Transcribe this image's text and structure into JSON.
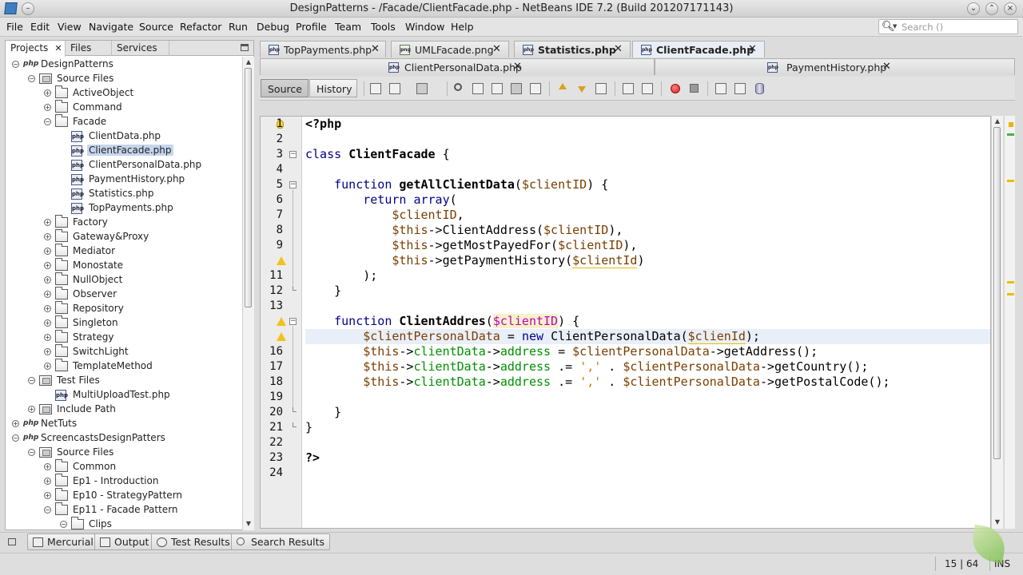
{
  "window": {
    "title": "DesignPatterns - /Facade/ClientFacade.php - NetBeans IDE 7.2 (Build 201207171143)"
  },
  "menu": {
    "items": [
      "File",
      "Edit",
      "View",
      "Navigate",
      "Source",
      "Refactor",
      "Run",
      "Debug",
      "Profile",
      "Team",
      "Tools",
      "Window",
      "Help"
    ]
  },
  "search": {
    "placeholder": "Search ()"
  },
  "left_panel": {
    "tabs": [
      "Projects",
      "Files",
      "Services"
    ],
    "tree": [
      {
        "label": "DesignPatterns",
        "type": "project"
      },
      {
        "label": "Source Files",
        "type": "srcfolder"
      },
      {
        "label": "ActiveObject",
        "type": "folder"
      },
      {
        "label": "Command",
        "type": "folder"
      },
      {
        "label": "Facade",
        "type": "folder"
      },
      {
        "label": "ClientData.php",
        "type": "php"
      },
      {
        "label": "ClientFacade.php",
        "type": "php",
        "selected": true
      },
      {
        "label": "ClientPersonalData.php",
        "type": "php"
      },
      {
        "label": "PaymentHistory.php",
        "type": "php"
      },
      {
        "label": "Statistics.php",
        "type": "php"
      },
      {
        "label": "TopPayments.php",
        "type": "php"
      },
      {
        "label": "Factory",
        "type": "folder"
      },
      {
        "label": "Gateway&Proxy",
        "type": "folder"
      },
      {
        "label": "Mediator",
        "type": "folder"
      },
      {
        "label": "Monostate",
        "type": "folder"
      },
      {
        "label": "NullObject",
        "type": "folder"
      },
      {
        "label": "Observer",
        "type": "folder"
      },
      {
        "label": "Repository",
        "type": "folder"
      },
      {
        "label": "Singleton",
        "type": "folder"
      },
      {
        "label": "Strategy",
        "type": "folder"
      },
      {
        "label": "SwitchLight",
        "type": "folder"
      },
      {
        "label": "TemplateMethod",
        "type": "folder"
      },
      {
        "label": "Test Files",
        "type": "srcfolder"
      },
      {
        "label": "MultiUploadTest.php",
        "type": "php"
      },
      {
        "label": "Include Path",
        "type": "srcfolder"
      },
      {
        "label": "NetTuts",
        "type": "project"
      },
      {
        "label": "ScreencastsDesignPatters",
        "type": "project"
      },
      {
        "label": "Source Files",
        "type": "srcfolder"
      },
      {
        "label": "Common",
        "type": "folder"
      },
      {
        "label": "Ep1 - Introduction",
        "type": "folder"
      },
      {
        "label": "Ep10 - StrategyPattern",
        "type": "folder"
      },
      {
        "label": "Ep11 - Facade Pattern",
        "type": "folder"
      },
      {
        "label": "Clips",
        "type": "folder"
      }
    ]
  },
  "editor_tabs": {
    "row1": [
      "TopPayments.php",
      "UMLFacade.png",
      "Statistics.php",
      "ClientFacade.php"
    ],
    "row2": [
      "ClientPersonalData.php",
      "PaymentHistory.php"
    ]
  },
  "editor_toolbar": {
    "source_label": "Source",
    "history_label": "History"
  },
  "code": {
    "line_numbers": [
      "1",
      "2",
      "3",
      "4",
      "5",
      "6",
      "7",
      "8",
      "9",
      "",
      "11",
      "12",
      "13",
      "",
      "",
      "16",
      "17",
      "18",
      "19",
      "20",
      "21",
      "22",
      "23",
      "24"
    ],
    "lines": [
      [
        [
          "kwb",
          "<?php"
        ]
      ],
      [],
      [
        [
          "kw",
          "class "
        ],
        [
          "fn",
          "ClientFacade"
        ],
        [
          "",
          " {"
        ]
      ],
      [],
      [
        [
          "",
          "    "
        ],
        [
          "kw",
          "function "
        ],
        [
          "fn",
          "getAllClientData"
        ],
        [
          "",
          "("
        ],
        [
          "var",
          "$clientID"
        ],
        [
          "",
          ") {"
        ]
      ],
      [
        [
          "",
          "        "
        ],
        [
          "kw",
          "return "
        ],
        [
          "kw",
          "array"
        ],
        [
          "",
          "("
        ]
      ],
      [
        [
          "",
          "            "
        ],
        [
          "var",
          "$clientID"
        ],
        [
          "",
          ","
        ]
      ],
      [
        [
          "",
          "            "
        ],
        [
          "var",
          "$this"
        ],
        [
          "",
          "->ClientAddress("
        ],
        [
          "var",
          "$clientID"
        ],
        [
          "",
          "),"
        ]
      ],
      [
        [
          "",
          "            "
        ],
        [
          "var",
          "$this"
        ],
        [
          "",
          "->getMostPayedFor("
        ],
        [
          "var",
          "$clientID"
        ],
        [
          "",
          "),"
        ]
      ],
      [
        [
          "",
          "            "
        ],
        [
          "var",
          "$this"
        ],
        [
          "",
          "->getPaymentHistory("
        ],
        [
          "varwarn",
          "$clientId"
        ],
        [
          "",
          ")"
        ]
      ],
      [
        [
          "",
          "        );"
        ]
      ],
      [
        [
          "",
          "    }"
        ]
      ],
      [],
      [
        [
          "",
          "    "
        ],
        [
          "kw",
          "function "
        ],
        [
          "fn",
          "ClientAddres"
        ],
        [
          "",
          "("
        ],
        [
          "hl",
          "$clientID"
        ],
        [
          "",
          ") {"
        ]
      ],
      [
        [
          "",
          "        "
        ],
        [
          "var",
          "$clientPersonalData"
        ],
        [
          "",
          " = "
        ],
        [
          "kw",
          "new "
        ],
        [
          "",
          "ClientPersonalData("
        ],
        [
          "varwarn",
          "$clienId"
        ],
        [
          "",
          ");"
        ]
      ],
      [
        [
          "",
          "        "
        ],
        [
          "var",
          "$this"
        ],
        [
          "",
          "->"
        ],
        [
          "prop",
          "clientData"
        ],
        [
          "",
          "->"
        ],
        [
          "prop",
          "address"
        ],
        [
          "",
          " = "
        ],
        [
          "var",
          "$clientPersonalData"
        ],
        [
          "",
          "->getAddress();"
        ]
      ],
      [
        [
          "",
          "        "
        ],
        [
          "var",
          "$this"
        ],
        [
          "",
          "->"
        ],
        [
          "prop",
          "clientData"
        ],
        [
          "",
          "->"
        ],
        [
          "prop",
          "address"
        ],
        [
          "",
          " .= "
        ],
        [
          "str",
          "','"
        ],
        [
          "",
          " . "
        ],
        [
          "var",
          "$clientPersonalData"
        ],
        [
          "",
          "->getCountry();"
        ]
      ],
      [
        [
          "",
          "        "
        ],
        [
          "var",
          "$this"
        ],
        [
          "",
          "->"
        ],
        [
          "prop",
          "clientData"
        ],
        [
          "",
          "->"
        ],
        [
          "prop",
          "address"
        ],
        [
          "",
          " .= "
        ],
        [
          "str",
          "','"
        ],
        [
          "",
          " . "
        ],
        [
          "var",
          "$clientPersonalData"
        ],
        [
          "",
          "->getPostalCode();"
        ]
      ],
      [],
      [
        [
          "",
          "    }"
        ]
      ],
      [
        [
          "",
          "}"
        ]
      ],
      [],
      [
        [
          "kwb",
          "?>"
        ]
      ],
      []
    ]
  },
  "bottom_bar": {
    "buttons": [
      "Mercurial",
      "Output",
      "Test Results",
      "Search Results"
    ]
  },
  "status": {
    "position": "15 | 64",
    "mode": "INS"
  }
}
